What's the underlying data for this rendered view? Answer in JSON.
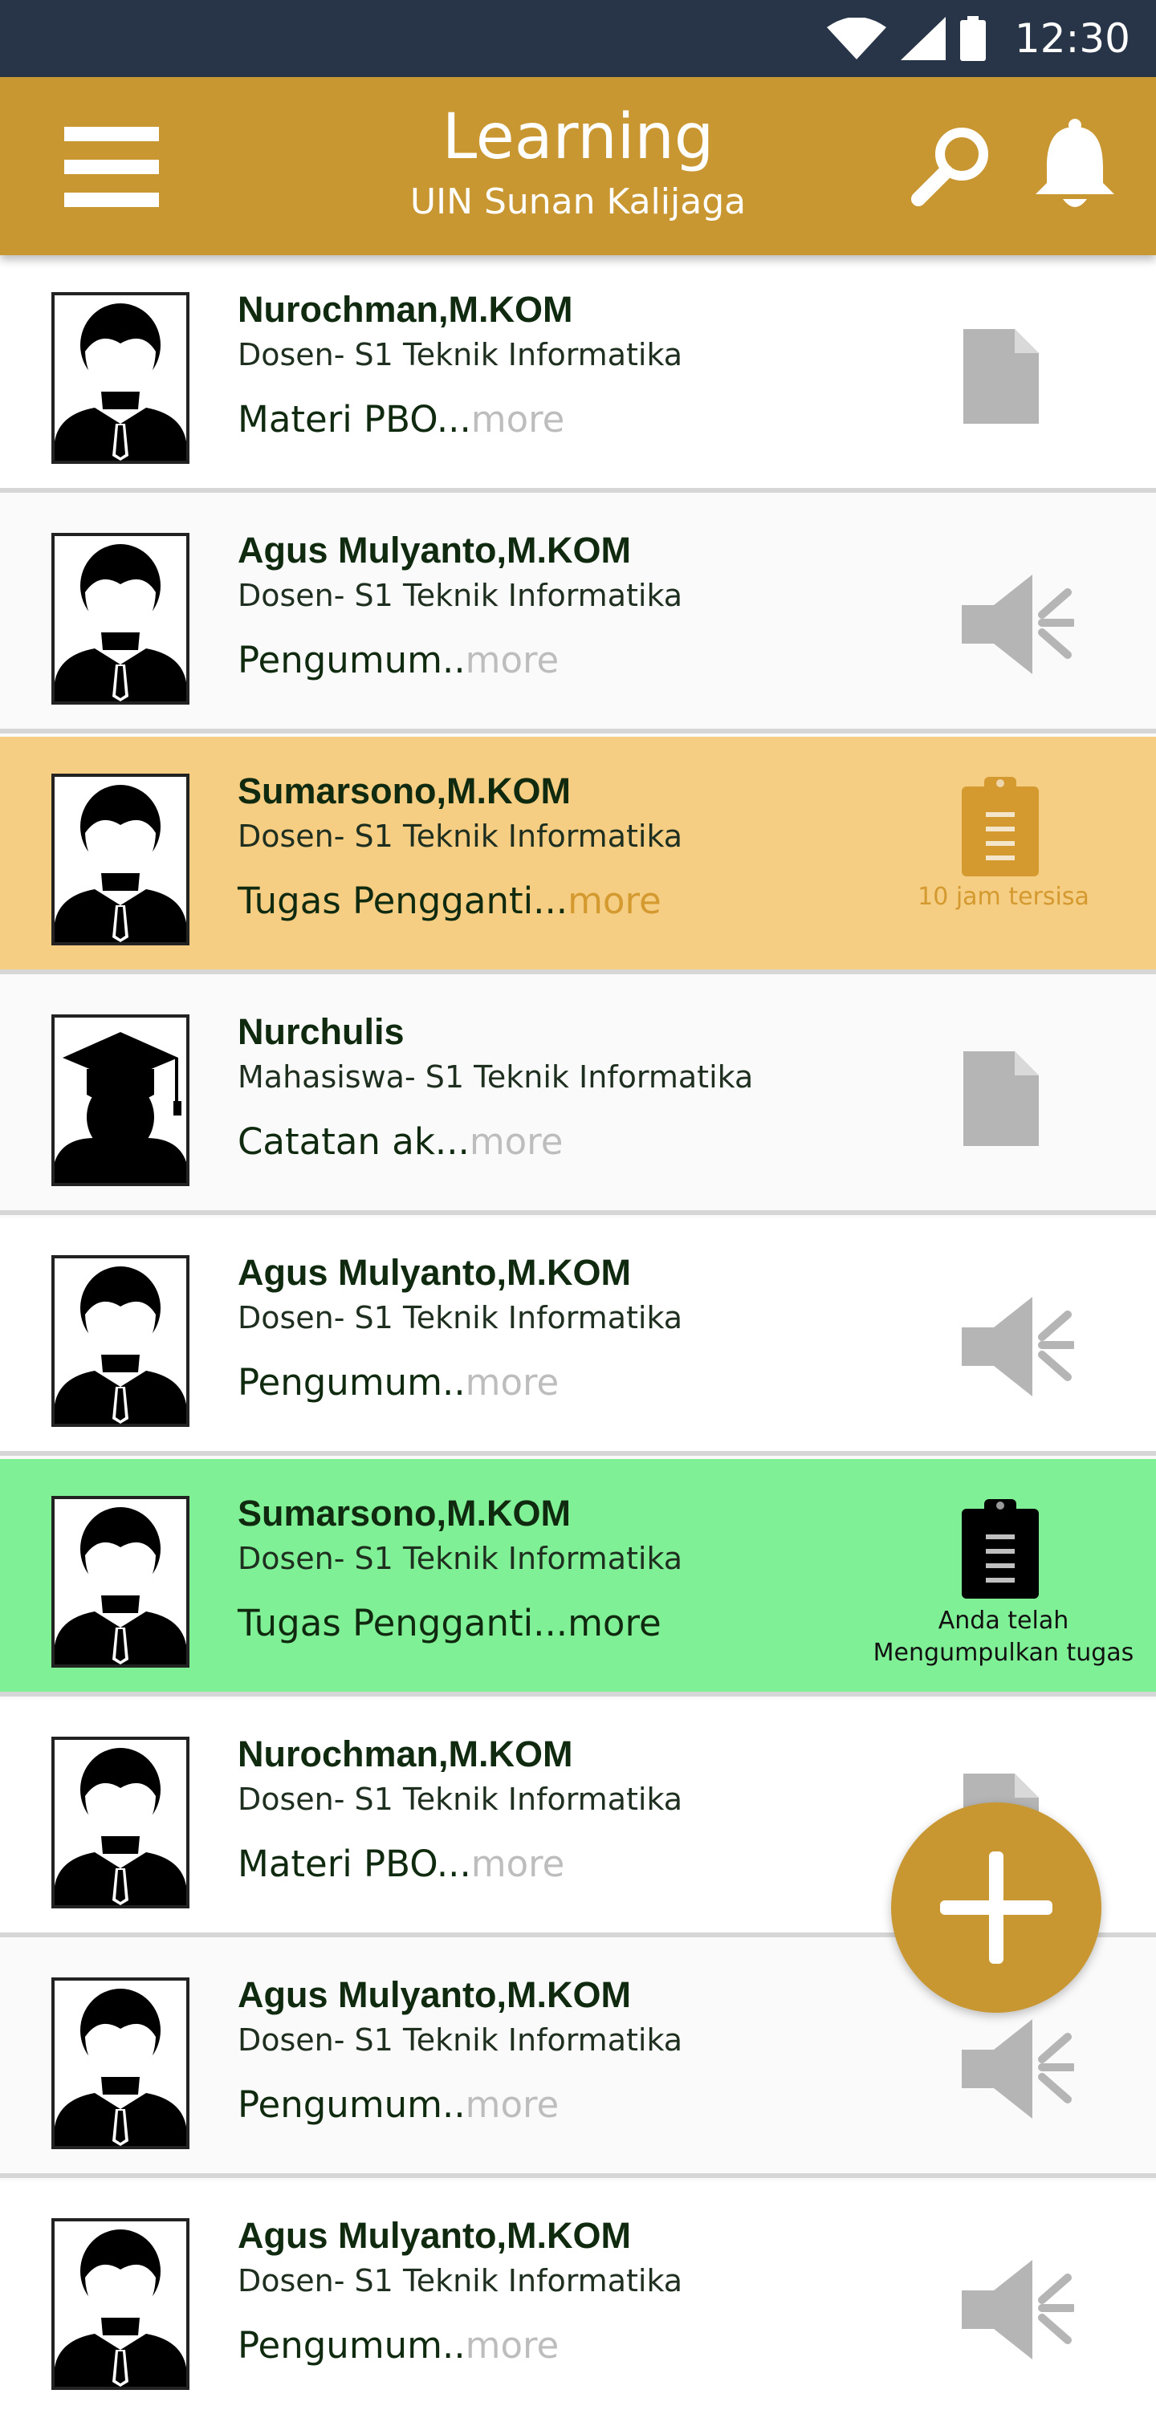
{
  "status_bar": {
    "time": "12:30",
    "icons": [
      "wifi-icon",
      "signal-icon",
      "battery-icon"
    ]
  },
  "app_bar": {
    "title": "Learning",
    "subtitle": "UIN Sunan Kalijaga",
    "icons": [
      "menu-icon",
      "search-icon",
      "bell-icon"
    ]
  },
  "colors": {
    "status_bar": "#283548",
    "app_bar": "#c99731",
    "row_deadline": "#f5cd83",
    "row_submitted": "#80f096",
    "icon_gray": "#b5b5b5",
    "more_gray": "#bdbdbd",
    "more_orange": "#d49a30"
  },
  "posts": [
    {
      "name": "Nurochman,M.KOM",
      "role": " Dosen- S1 Teknik Informatika",
      "preview": "Materi PBO...",
      "more": "more",
      "icon": "document-icon",
      "avatar": "lecturer-avatar"
    },
    {
      "name": "Agus Mulyanto,M.KOM",
      "role": "Dosen- S1 Teknik Informatika",
      "preview": " Pengumum..",
      "more": "more",
      "icon": "megaphone-icon",
      "avatar": "lecturer-avatar"
    },
    {
      "name": "Sumarsono,M.KOM",
      "role": "Dosen- S1 Teknik Informatika",
      "preview": "Tugas Pengganti...",
      "more": "more",
      "icon": "clipboard-icon",
      "caption": "10 jam tersisa",
      "avatar": "lecturer-avatar"
    },
    {
      "name": "Nurchulis",
      "role": "Mahasiswa- S1 Teknik Informatika",
      "preview": " Catatan ak...",
      "more": "more",
      "icon": "document-icon",
      "avatar": "student-avatar"
    },
    {
      "name": "Agus Mulyanto,M.KOM",
      "role": " Dosen- S1 Teknik Informatika",
      "preview": " Pengumum..",
      "more": "more",
      "icon": "megaphone-icon",
      "avatar": "lecturer-avatar"
    },
    {
      "name": "Sumarsono,M.KOM",
      "role": "Dosen- S1 Teknik Informatika",
      "preview": "Tugas Pengganti...",
      "more": "more",
      "icon": "clipboard-icon",
      "caption": "Anda telah Mengumpulkan tugas",
      "avatar": "lecturer-avatar"
    },
    {
      "name": "Nurochman,M.KOM",
      "role": "Dosen- S1 Teknik Informatika",
      "preview": "Materi PBO...",
      "more": "more",
      "icon": "document-icon",
      "avatar": "lecturer-avatar"
    },
    {
      "name": "Agus Mulyanto,M.KOM",
      "role": "Dosen- S1 Teknik Informatika",
      "preview": " Pengumum..",
      "more": "more",
      "icon": "megaphone-icon",
      "avatar": "lecturer-avatar"
    },
    {
      "name": "Agus Mulyanto,M.KOM",
      "role": "Dosen- S1 Teknik Informatika",
      "preview": " Pengumum..",
      "more": "more",
      "icon": "megaphone-icon",
      "avatar": "lecturer-avatar"
    }
  ],
  "fab": {
    "icon": "plus-icon"
  }
}
